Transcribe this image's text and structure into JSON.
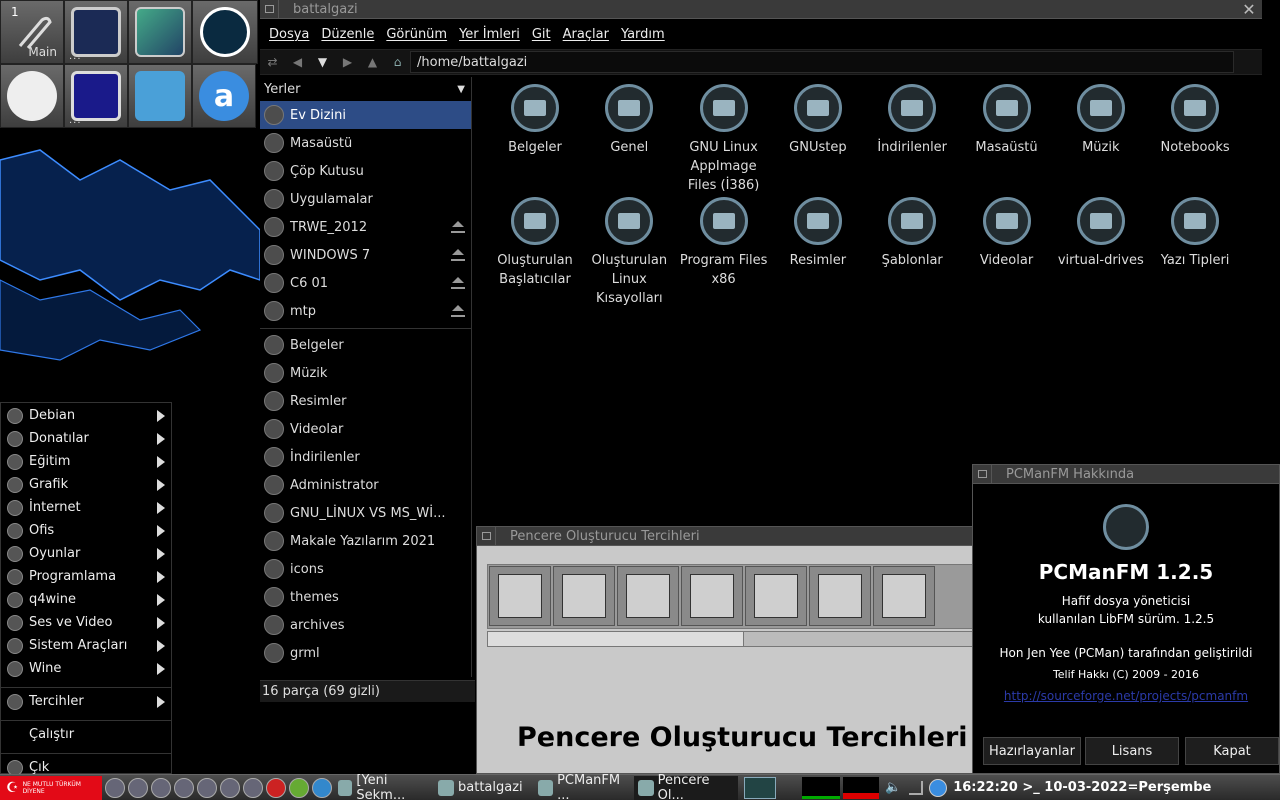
{
  "dock": {
    "workspace_number": "1",
    "workspace_label": "Main",
    "dots": "..."
  },
  "file_manager": {
    "title": "battalgazi",
    "menu": [
      "Dosya",
      "Düzenle",
      "Görünüm",
      "Yer İmleri",
      "Git",
      "Araçlar",
      "Yardım"
    ],
    "path": "/home/battalgazi",
    "sidebar_header": "Yerler",
    "places": [
      {
        "label": "Ev Dizini",
        "icon": "home-icon",
        "selected": true,
        "eject": false
      },
      {
        "label": "Masaüstü",
        "icon": "desktop-icon",
        "eject": false
      },
      {
        "label": "Çöp Kutusu",
        "icon": "trash-icon",
        "eject": false
      },
      {
        "label": "Uygulamalar",
        "icon": "applications-icon",
        "eject": false
      },
      {
        "label": "TRWE_2012",
        "icon": "drive-icon",
        "eject": true
      },
      {
        "label": "WINDOWS 7",
        "icon": "drive-icon",
        "eject": true
      },
      {
        "label": "C6 01",
        "icon": "phone-icon",
        "eject": true
      },
      {
        "label": "mtp",
        "icon": "media-icon",
        "eject": true
      }
    ],
    "bookmarks": [
      {
        "label": "Belgeler",
        "icon": "documents-icon"
      },
      {
        "label": "Müzik",
        "icon": "music-icon"
      },
      {
        "label": "Resimler",
        "icon": "pictures-icon"
      },
      {
        "label": "Videolar",
        "icon": "videos-icon"
      },
      {
        "label": "İndirilenler",
        "icon": "download-icon"
      },
      {
        "label": "Administrator",
        "icon": "folder-icon"
      },
      {
        "label": "GNU_LİNUX VS MS_Wİ...",
        "icon": "folder-icon"
      },
      {
        "label": "Makale Yazılarım 2021",
        "icon": "folder-icon"
      },
      {
        "label": "icons",
        "icon": "folder-icon"
      },
      {
        "label": "themes",
        "icon": "folder-icon"
      },
      {
        "label": "archives",
        "icon": "folder-icon"
      },
      {
        "label": "grml",
        "icon": "folder-icon"
      }
    ],
    "status": "16 parça (69 gizli)",
    "files": [
      {
        "name": "Belgeler",
        "icon": "documents-icon"
      },
      {
        "name": "Genel",
        "icon": "public-icon"
      },
      {
        "name": "GNU Linux AppImage Files (İ386)",
        "icon": "folder-icon"
      },
      {
        "name": "GNUstep",
        "icon": "folder-icon"
      },
      {
        "name": "İndirilenler",
        "icon": "download-icon"
      },
      {
        "name": "Masaüstü",
        "icon": "desktop-icon"
      },
      {
        "name": "Müzik",
        "icon": "music-icon"
      },
      {
        "name": "Notebooks",
        "icon": "folder-icon"
      },
      {
        "name": "Oluşturulan Başlatıcılar",
        "icon": "folder-icon"
      },
      {
        "name": "Oluşturulan Linux Kısayolları",
        "icon": "folder-icon"
      },
      {
        "name": "Program Files x86",
        "icon": "folder-icon"
      },
      {
        "name": "Resimler",
        "icon": "pictures-icon"
      },
      {
        "name": "Şablonlar",
        "icon": "templates-icon"
      },
      {
        "name": "Videolar",
        "icon": "videos-icon"
      },
      {
        "name": "virtual-drives",
        "icon": "folder-icon"
      },
      {
        "name": "Yazı Tipleri",
        "icon": "folder-icon"
      }
    ]
  },
  "prefs": {
    "title": "Pencere Oluşturucu Tercihleri",
    "heading": "Pencere Oluşturucu Tercihleri"
  },
  "about": {
    "title": "PCManFM Hakkında",
    "app_name": "PCManFM 1.2.5",
    "desc1": "Hafif dosya yöneticisi",
    "desc2": "kullanılan LibFM sürüm. 1.2.5",
    "author": "Hon Jen Yee (PCMan) tarafından geliştirildi",
    "copyright": "Telif Hakkı (C) 2009 - 2016",
    "link": "http://sourceforge.net/projects/pcmanfm",
    "btn_credits": "Hazırlayanlar",
    "btn_license": "Lisans",
    "btn_close": "Kapat"
  },
  "appmenu": {
    "items": [
      "Debian",
      "Donatılar",
      "Eğitim",
      "Grafik",
      "İnternet",
      "Ofis",
      "Oyunlar",
      "Programlama",
      "q4wine",
      "Ses ve Video",
      "Sistem Araçları",
      "Wine"
    ],
    "prefs": "Tercihler",
    "run": "Çalıştır",
    "quit": "Çık"
  },
  "taskbar": {
    "flag_text": "NE MUTLU TÜRKÜM DİYENE",
    "tasks": [
      "[Yeni Sekm...",
      "battalgazi",
      "PCManFM ...",
      "Pencere Ol..."
    ],
    "clock": "16:22:20 >_ 10-03-2022=Perşembe"
  },
  "colors": {
    "selection": "#2d4c86",
    "flag": "#e30a17",
    "icon_ring": "#6f8ea0"
  }
}
